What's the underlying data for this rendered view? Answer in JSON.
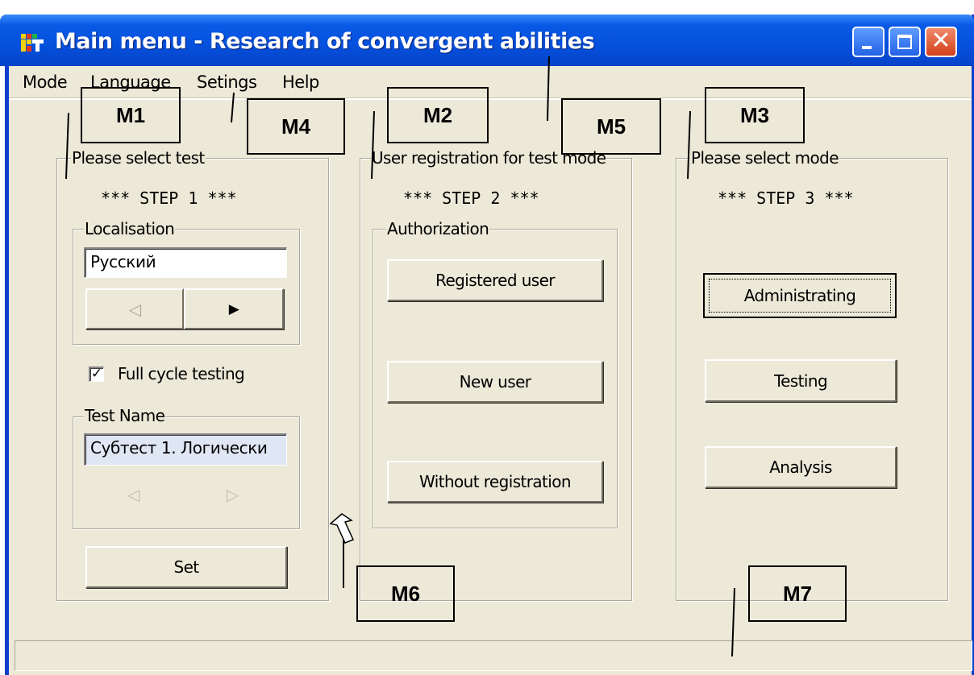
{
  "window": {
    "title": "Main menu - Research of convergent abilities",
    "icon": "app-test-icon",
    "controls": {
      "minimize": "minimize-icon",
      "maximize": "maximize-icon",
      "close": "close-icon",
      "close_glyph": "✕"
    }
  },
  "menu": {
    "items": [
      "Mode",
      "Language",
      "Setings",
      "Help"
    ]
  },
  "panel1": {
    "legend": "Please select test",
    "step": "*** STEP 1 ***",
    "localisation": {
      "legend": "Localisation",
      "value": "Русский",
      "prev_glyph": "◁",
      "next_glyph": "▶"
    },
    "full_cycle": {
      "label": "Full cycle testing",
      "checked": true,
      "check_glyph": "✓"
    },
    "test_name": {
      "legend": "Test Name",
      "value": "Субтест 1. Логически",
      "prev_glyph": "◁",
      "next_glyph": "▷"
    },
    "set_button": "Set"
  },
  "panel2": {
    "legend": "User registration for test mode",
    "step": "*** STEP 2 ***",
    "authorization": {
      "legend": "Authorization",
      "buttons": [
        "Registered user",
        "New user",
        "Without registration"
      ]
    }
  },
  "panel3": {
    "legend": "Please select mode",
    "step": "*** STEP 3 ***",
    "buttons": [
      "Administrating",
      "Testing",
      "Analysis"
    ]
  },
  "status": {
    "text": ""
  },
  "annotations": [
    "M1",
    "M2",
    "M3",
    "M4",
    "M5",
    "M6",
    "M7"
  ],
  "colors": {
    "titlebar": "#0550dc",
    "face": "#ece9d8",
    "close_button": "#d2401c"
  }
}
